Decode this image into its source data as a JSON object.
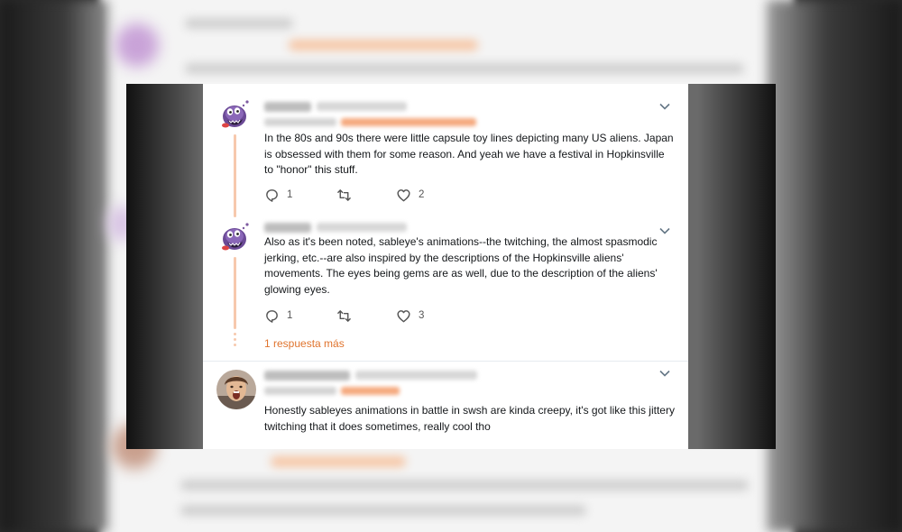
{
  "tweets": [
    {
      "text": "In the 80s and 90s there were little capsule toy lines depicting many US aliens. Japan is obsessed with them for some reason. And yeah we have a festival in Hopkinsville to \"honor\" this stuff.",
      "replies": "1",
      "likes": "2",
      "avatar": "sableye-avatar"
    },
    {
      "text": "Also as it's been noted, sableye's animations--the twitching, the almost spasmodic jerking, etc.--are also inspired by the descriptions of the Hopkinsville aliens' movements. The eyes being gems are as well, due to the description of the aliens' glowing eyes.",
      "replies": "1",
      "likes": "3",
      "avatar": "sableye-avatar"
    },
    {
      "text": "Honestly sableyes animations in battle in swsh are kinda creepy, it's got like this jittery twitching that it does sometimes, really cool tho",
      "avatar": "person-avatar"
    }
  ],
  "more_replies_label": "1 respuesta más",
  "icons": [
    "reply-icon",
    "retweet-icon",
    "like-icon",
    "chevron-down-icon"
  ],
  "colors": {
    "accent": "#e0742e",
    "thread_line": "#f7c9ad",
    "text": "#14171a",
    "icon": "#555555"
  }
}
